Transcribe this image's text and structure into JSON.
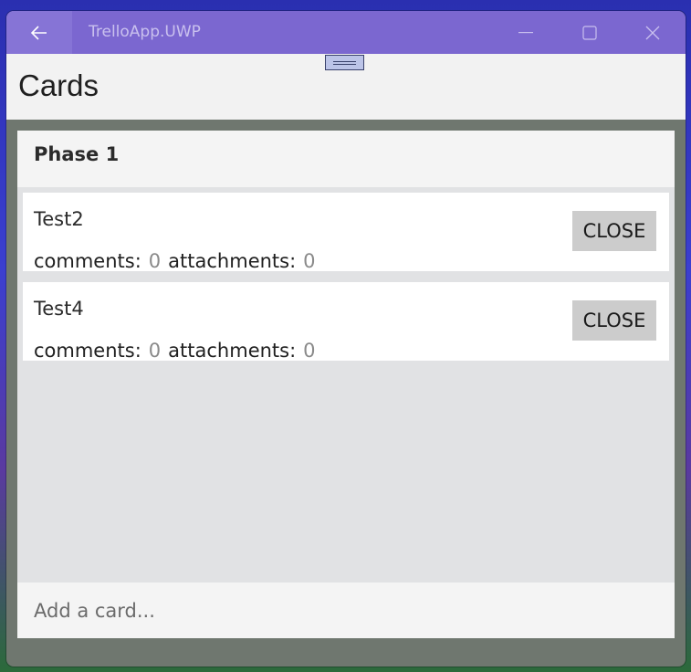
{
  "window": {
    "title": "TrelloApp.UWP",
    "accent": "#7b67d0",
    "icons": {
      "back": "back-arrow-icon",
      "minimize": "minimize-icon",
      "maximize": "maximize-icon",
      "close": "close-icon"
    }
  },
  "page": {
    "title": "Cards"
  },
  "list": {
    "title": "Phase 1",
    "cards": [
      {
        "title": "Test2",
        "comments_label": "comments:",
        "comments": "0",
        "attachments_label": "attachments:",
        "attachments": "0",
        "close_label": "CLOSE"
      },
      {
        "title": "Test4",
        "comments_label": "comments:",
        "comments": "0",
        "attachments_label": "attachments:",
        "attachments": "0",
        "close_label": "CLOSE"
      }
    ],
    "add_card_placeholder": "Add a card..."
  }
}
